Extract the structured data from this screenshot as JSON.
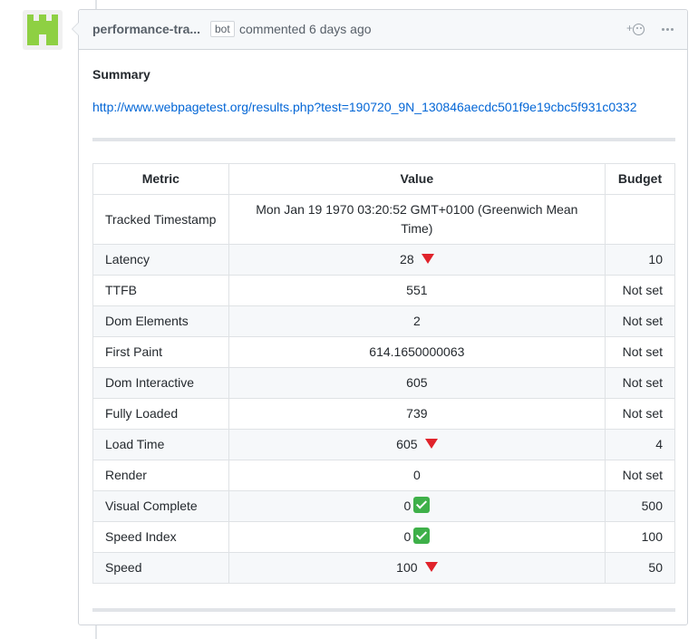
{
  "comment": {
    "author": "performance-tra...",
    "bot_label": "bot",
    "meta": "commented 6 days ago",
    "reaction": "+",
    "summary_title": "Summary",
    "link": "http://www.webpagetest.org/results.php?test=190720_9N_130846aecdc501f9e19cbc5f931c0332"
  },
  "table": {
    "headers": [
      "Metric",
      "Value",
      "Budget"
    ],
    "rows": [
      {
        "metric": "Tracked Timestamp",
        "value": "Mon Jan 19 1970 03:20:52 GMT+0100 (Greenwich Mean Time)",
        "budget": "",
        "status": ""
      },
      {
        "metric": "Latency",
        "value": "28",
        "budget": "10",
        "status": "over-budget-icon"
      },
      {
        "metric": "TTFB",
        "value": "551",
        "budget": "Not set",
        "status": ""
      },
      {
        "metric": "Dom Elements",
        "value": "2",
        "budget": "Not set",
        "status": ""
      },
      {
        "metric": "First Paint",
        "value": "614.1650000063",
        "budget": "Not set",
        "status": ""
      },
      {
        "metric": "Dom Interactive",
        "value": "605",
        "budget": "Not set",
        "status": ""
      },
      {
        "metric": "Fully Loaded",
        "value": "739",
        "budget": "Not set",
        "status": ""
      },
      {
        "metric": "Load Time",
        "value": "605",
        "budget": "4",
        "status": "over-budget-icon"
      },
      {
        "metric": "Render",
        "value": "0",
        "budget": "Not set",
        "status": ""
      },
      {
        "metric": "Visual Complete",
        "value": "0",
        "budget": "500",
        "status": "within-budget-icon"
      },
      {
        "metric": "Speed Index",
        "value": "0",
        "budget": "100",
        "status": "within-budget-icon"
      },
      {
        "metric": "Speed",
        "value": "100",
        "budget": "50",
        "status": "over-budget-icon"
      }
    ]
  },
  "colors": {
    "link": "#0366d6",
    "over_budget": "#e0232b",
    "within_budget": "#3eb049",
    "avatar": "#8ed043"
  }
}
